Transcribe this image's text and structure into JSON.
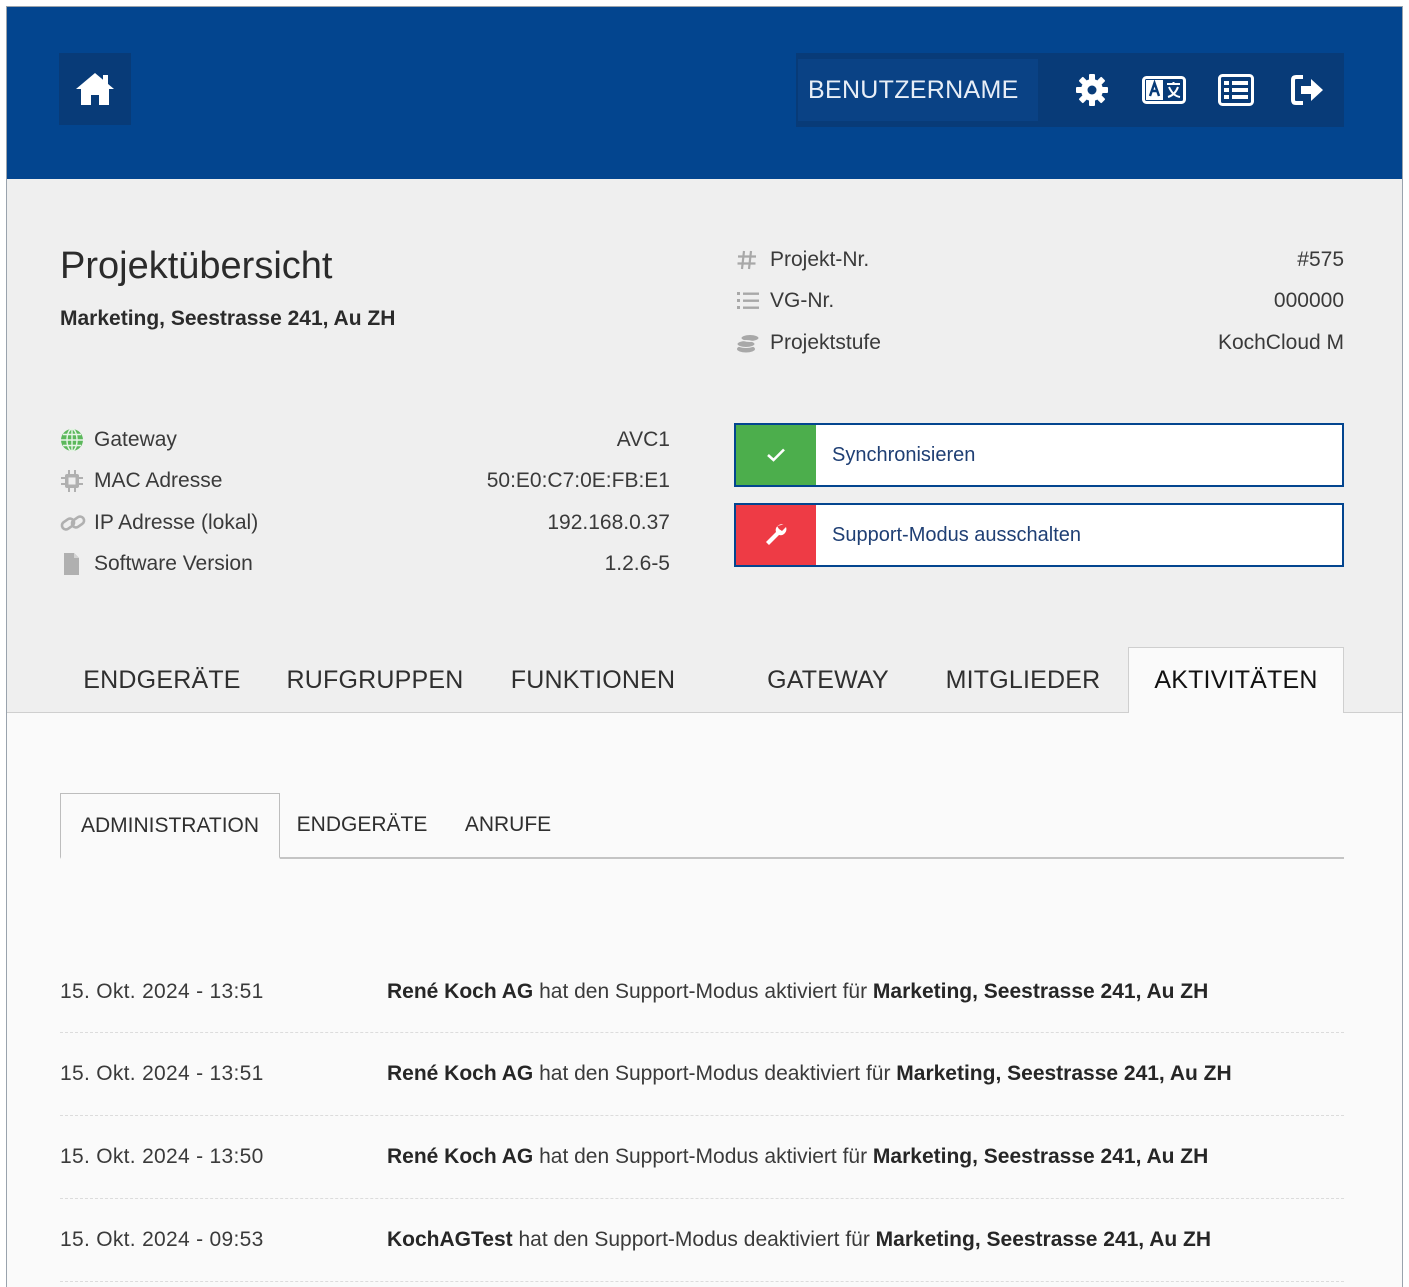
{
  "header": {
    "username": "BENUTZERNAME",
    "icons": [
      "home-icon",
      "gear-icon",
      "translate-icon",
      "list-icon",
      "logout-icon"
    ]
  },
  "overview": {
    "title": "Projektübersicht",
    "subtitle": "Marketing, Seestrasse 241, Au ZH",
    "project_info": [
      {
        "icon": "hash-icon",
        "label": "Projekt-Nr.",
        "value": "#575"
      },
      {
        "icon": "numbered-list-icon",
        "label": "VG-Nr.",
        "value": "000000"
      },
      {
        "icon": "coins-icon",
        "label": "Projektstufe",
        "value": "KochCloud M"
      }
    ],
    "gateway_info": [
      {
        "icon": "globe-icon",
        "label": "Gateway",
        "value": "AVC1"
      },
      {
        "icon": "chip-icon",
        "label": "MAC Adresse",
        "value": "50:E0:C7:0E:FB:E1"
      },
      {
        "icon": "link-icon",
        "label": "IP Adresse (lokal)",
        "value": "192.168.0.37"
      },
      {
        "icon": "file-icon",
        "label": "Software Version",
        "value": "1.2.6-5"
      }
    ],
    "actions": {
      "sync_label": "Synchronisieren",
      "support_label": "Support-Modus ausschalten"
    }
  },
  "colors": {
    "header": "#03458f",
    "sync_green": "#4cae4c",
    "support_red": "#ee3b45"
  },
  "main_tabs": [
    "ENDGERÄTE",
    "RUFGRUPPEN",
    "FUNKTIONEN",
    "GATEWAY",
    "MITGLIEDER",
    "AKTIVITÄTEN"
  ],
  "active_main_tab": "AKTIVITÄTEN",
  "sub_tabs": [
    "ADMINISTRATION",
    "ENDGERÄTE",
    "ANRUFE"
  ],
  "active_sub_tab": "ADMINISTRATION",
  "activity_log": [
    {
      "date": "15. Okt. 2024 - 13:51",
      "actor": "René Koch AG",
      "action": " hat den Support-Modus aktiviert für ",
      "target": "Marketing, Seestrasse 241, Au ZH"
    },
    {
      "date": "15. Okt. 2024 - 13:51",
      "actor": "René Koch AG",
      "action": " hat den Support-Modus deaktiviert für ",
      "target": "Marketing, Seestrasse 241, Au ZH"
    },
    {
      "date": "15. Okt. 2024 - 13:50",
      "actor": "René Koch AG",
      "action": " hat den Support-Modus aktiviert für ",
      "target": "Marketing, Seestrasse 241, Au ZH"
    },
    {
      "date": "15. Okt. 2024 - 09:53",
      "actor": "KochAGTest",
      "action": " hat den Support-Modus deaktiviert für ",
      "target": "Marketing, Seestrasse 241, Au ZH"
    }
  ]
}
